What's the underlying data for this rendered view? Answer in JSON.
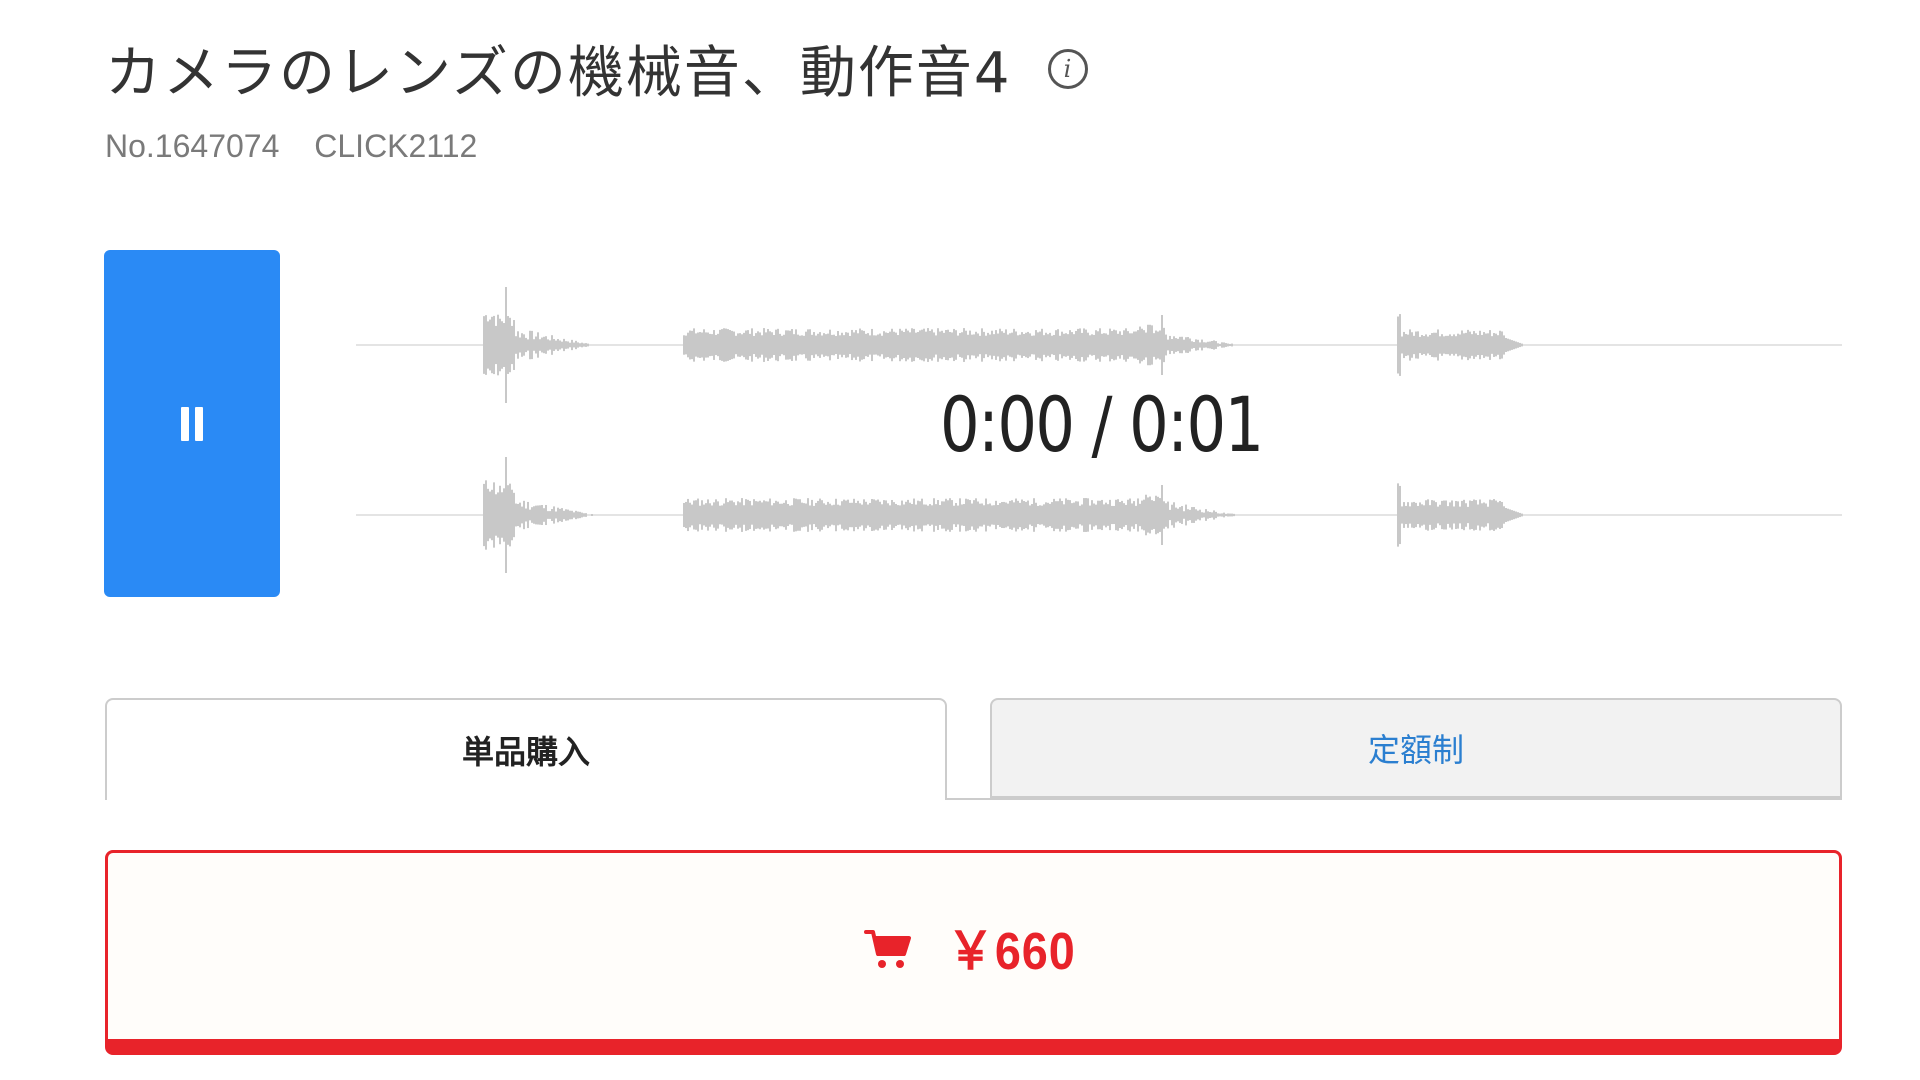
{
  "product": {
    "title": "カメラのレンズの機械音、動作音4",
    "number": "No.1647074",
    "code": "CLICK2112"
  },
  "player": {
    "state": "playing",
    "time_display": "0:00 / 0:01",
    "play_button_color": "#2a8af5"
  },
  "tabs": [
    {
      "label": "単品購入",
      "active": true
    },
    {
      "label": "定額制",
      "active": false,
      "color": "#2b7fd0"
    }
  ],
  "purchase": {
    "price": "￥660",
    "accent_color": "#e8232a",
    "icon": "cart-icon"
  },
  "icons": {
    "info": "info-icon",
    "pause": "pause-icon",
    "cart": "cart-icon"
  }
}
